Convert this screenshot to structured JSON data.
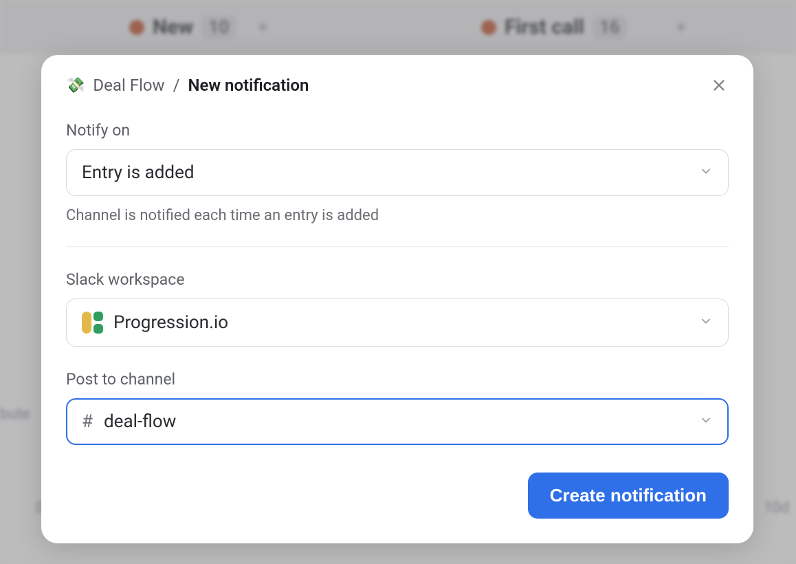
{
  "background": {
    "columns": [
      {
        "name": "New",
        "count": "10"
      },
      {
        "name": "First call",
        "count": "16"
      }
    ],
    "side_left": "bute",
    "side_right_top": "10d",
    "side_right_bottom": "0"
  },
  "modal": {
    "breadcrumb": {
      "parent": "Deal Flow",
      "separator": "/",
      "current": "New notification"
    },
    "notify_on": {
      "label": "Notify on",
      "value": "Entry is added",
      "helper": "Channel is notified each time an entry is added"
    },
    "workspace": {
      "label": "Slack workspace",
      "value": "Progression.io"
    },
    "channel": {
      "label": "Post to channel",
      "prefix": "#",
      "value": "deal-flow"
    },
    "submit_label": "Create notification"
  }
}
